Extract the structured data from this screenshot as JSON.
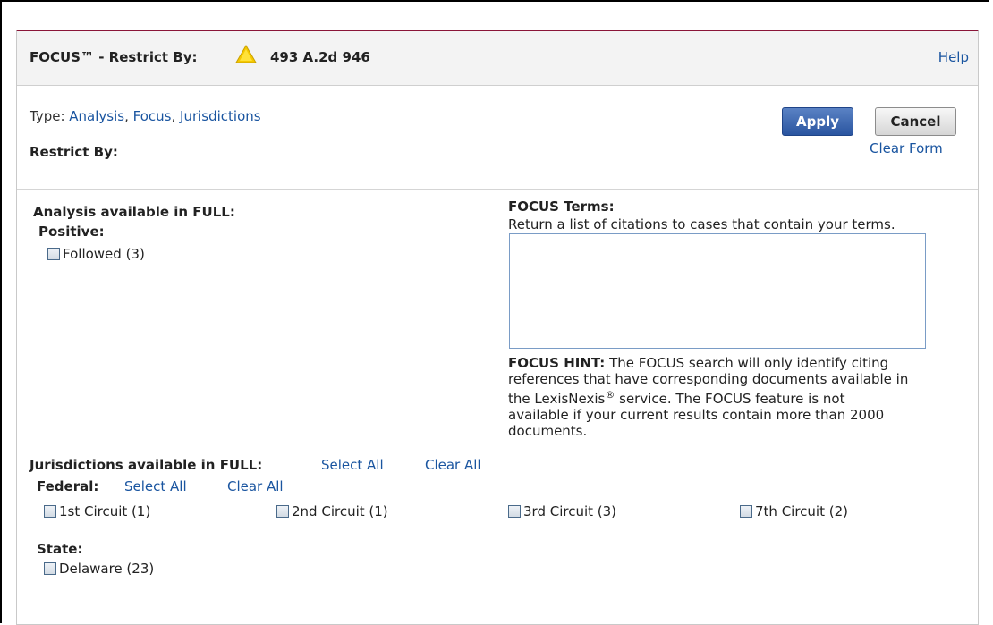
{
  "header": {
    "title": "FOCUS™ - Restrict By:",
    "citation": "493 A.2d 946",
    "help_label": "Help"
  },
  "type_line": {
    "prefix": "Type: ",
    "links": [
      "Analysis",
      "Focus",
      "Jurisdictions"
    ]
  },
  "restrict_label": "Restrict By:",
  "buttons": {
    "apply": "Apply",
    "cancel": "Cancel",
    "clear_form": "Clear Form"
  },
  "analysis": {
    "title": "Analysis available in FULL:",
    "positive_label": "Positive:",
    "items": [
      {
        "label": "Followed (3)",
        "checked": false
      }
    ]
  },
  "focus_terms": {
    "title": "FOCUS Terms:",
    "description": "Return a list of citations to cases that contain your terms.",
    "value": "",
    "hint_label": "FOCUS HINT:",
    "hint_line1": " The FOCUS search will only identify citing",
    "hint_line2": "references that have corresponding documents available in",
    "hint_line3a": "the LexisNexis",
    "hint_reg": "®",
    "hint_line3b": " service. The FOCUS feature is not",
    "hint_line4": "available if your current results contain more than 2000",
    "hint_line5": "documents."
  },
  "jurisdictions": {
    "title": "Jurisdictions available in FULL:",
    "select_all": "Select All",
    "clear_all": "Clear All",
    "federal": {
      "label": "Federal:",
      "select_all": "Select All",
      "clear_all": "Clear All",
      "items": [
        {
          "label": "1st Circuit (1)",
          "checked": false
        },
        {
          "label": "2nd Circuit (1)",
          "checked": false
        },
        {
          "label": "3rd Circuit (3)",
          "checked": false
        },
        {
          "label": "7th Circuit (2)",
          "checked": false
        }
      ]
    },
    "state": {
      "label": "State:",
      "items": [
        {
          "label": "Delaware (23)",
          "checked": false
        }
      ]
    }
  },
  "colors": {
    "accent": "#8a1538",
    "link": "#1a55a0",
    "apply_button": "#2a55a0"
  },
  "icons": {
    "warning": "warning-triangle-icon"
  }
}
